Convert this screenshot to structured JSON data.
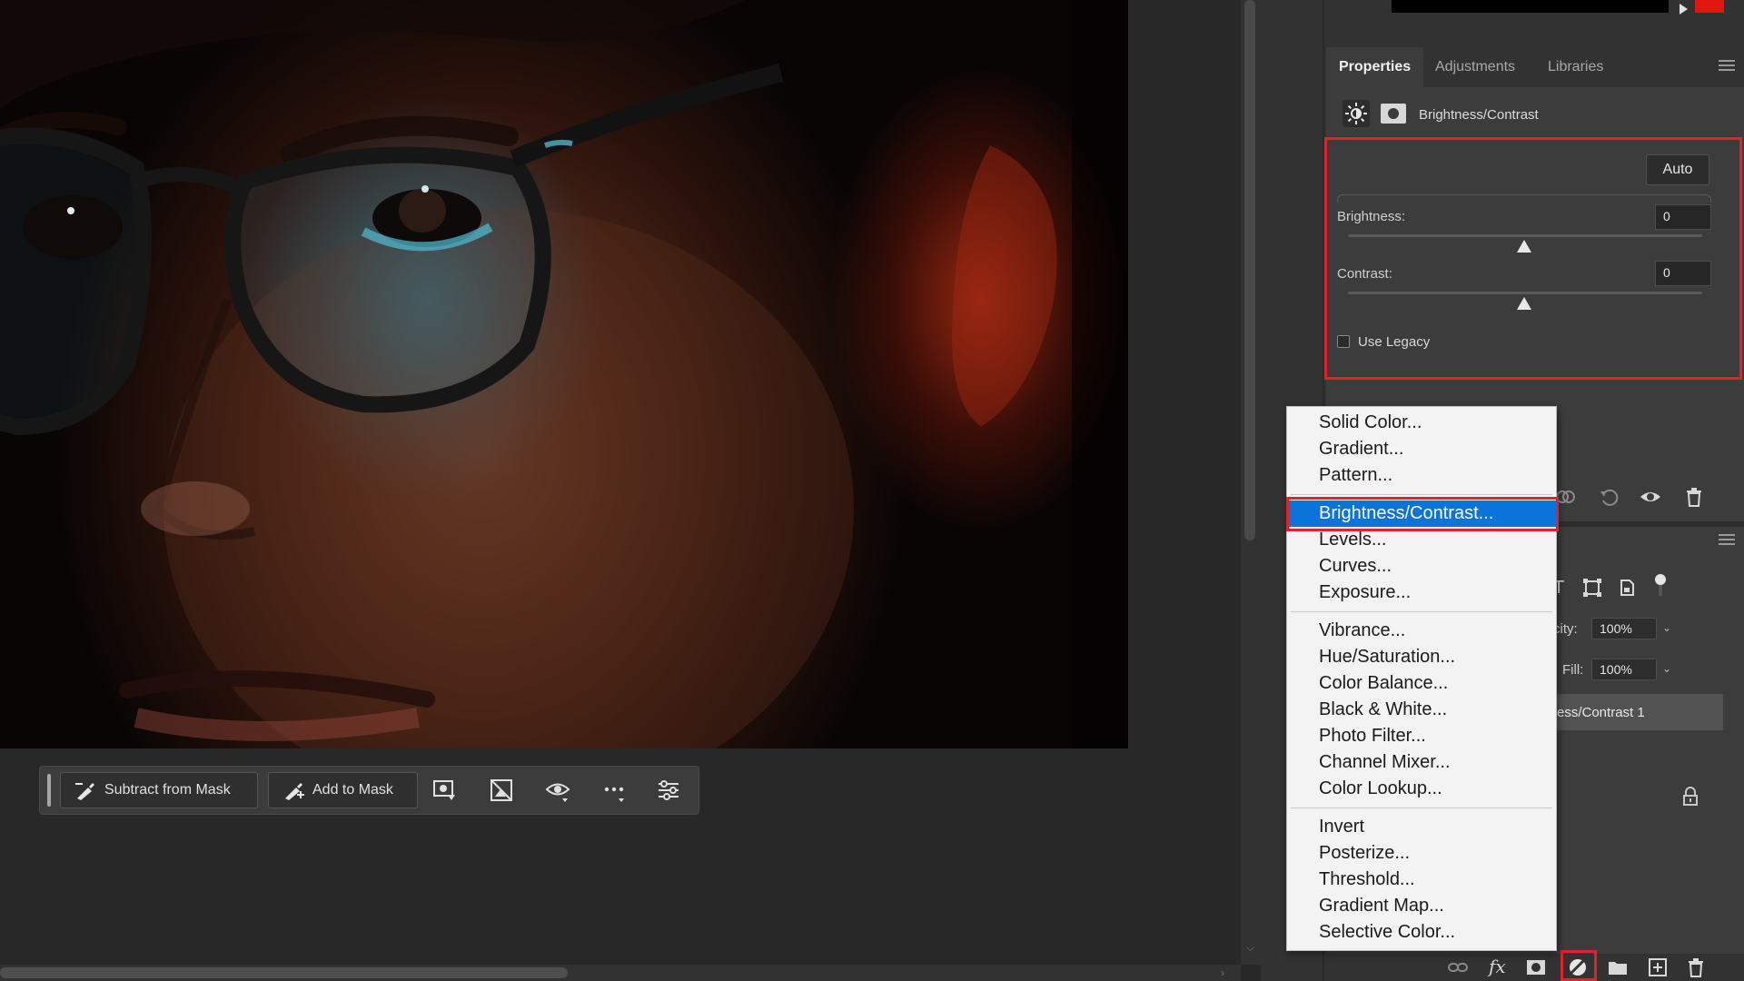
{
  "taskbar": {
    "subtract_label": "Subtract from Mask",
    "add_label": "Add to Mask"
  },
  "properties": {
    "tabs": [
      {
        "label": "Properties",
        "active": true
      },
      {
        "label": "Adjustments",
        "active": false
      },
      {
        "label": "Libraries",
        "active": false
      }
    ],
    "adjustment_title": "Brightness/Contrast",
    "auto_label": "Auto",
    "brightness_label": "Brightness:",
    "brightness_value": "0",
    "contrast_label": "Contrast:",
    "contrast_value": "0",
    "use_legacy_label": "Use Legacy",
    "use_legacy_checked": false
  },
  "layers": {
    "opacity_label": "city:",
    "opacity_value": "100%",
    "fill_label": "Fill:",
    "fill_value": "100%",
    "layer_name": "ess/Contrast 1"
  },
  "menu": {
    "groups": [
      [
        "Solid Color...",
        "Gradient...",
        "Pattern..."
      ],
      [
        "Brightness/Contrast...",
        "Levels...",
        "Curves...",
        "Exposure..."
      ],
      [
        "Vibrance...",
        "Hue/Saturation...",
        "Color Balance...",
        "Black & White...",
        "Photo Filter...",
        "Channel Mixer...",
        "Color Lookup..."
      ],
      [
        "Invert",
        "Posterize...",
        "Threshold...",
        "Gradient Map...",
        "Selective Color..."
      ]
    ],
    "highlighted": "Brightness/Contrast..."
  },
  "colors": {
    "highlight_red": "#e0232b",
    "menu_selection_blue": "#0a74da",
    "swatch_red": "#e0170e"
  }
}
